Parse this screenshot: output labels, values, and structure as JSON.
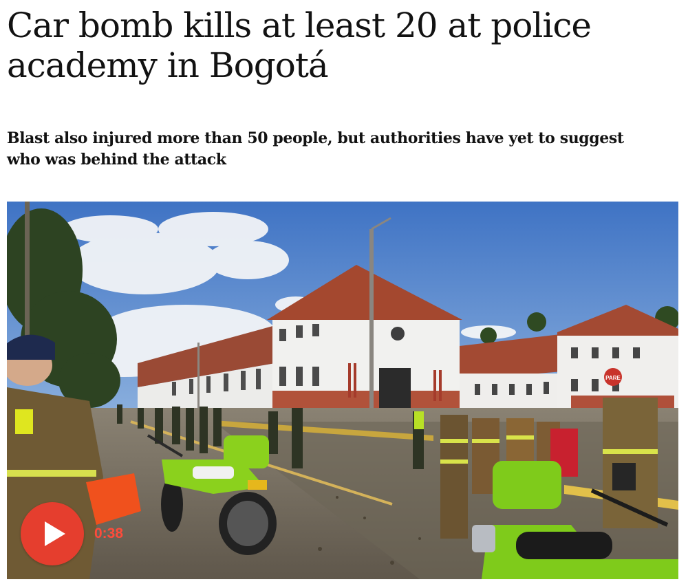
{
  "article": {
    "headline": "Car bomb kills at least 20 at police academy in Bogotá",
    "standfirst": "Blast also injured more than 50 people, but authorities have yet to suggest who was behind the attack"
  },
  "video": {
    "duration": "0:38",
    "play_icon": "play-icon",
    "sign_text": "PARE"
  },
  "colors": {
    "play_button": "#e53e2e",
    "duration_text": "#ff4b3a",
    "headline_text": "#121212"
  }
}
